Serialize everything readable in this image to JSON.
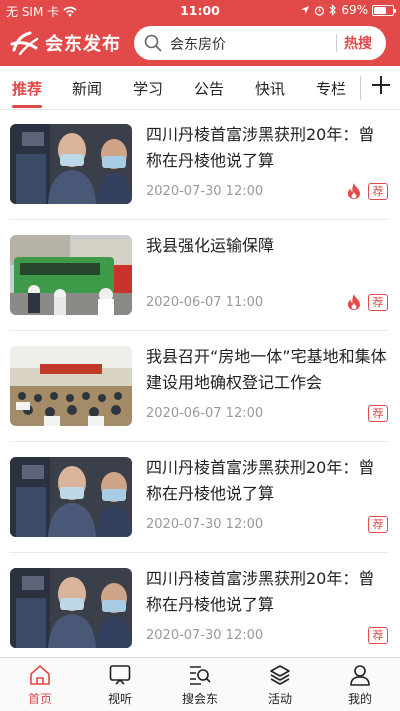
{
  "status_bar": {
    "carrier": "无 SIM 卡",
    "time": "11:00",
    "battery_text": "69%",
    "battery_level": 0.69
  },
  "header": {
    "logo_text": "会东发布",
    "search_placeholder": "会东房价",
    "hot_search_label": "热搜",
    "brand_color": "#e24a4a"
  },
  "tabs": [
    {
      "label": "推荐",
      "active": true
    },
    {
      "label": "新闻",
      "active": false
    },
    {
      "label": "学习",
      "active": false
    },
    {
      "label": "公告",
      "active": false
    },
    {
      "label": "快讯",
      "active": false
    },
    {
      "label": "专栏",
      "active": false
    }
  ],
  "news": [
    {
      "title": "四川丹棱首富涉黑获刑20年：曾称在丹棱他说了算",
      "date": "2020-07-30 12:00",
      "hot": true,
      "badge": "荐",
      "image": "court"
    },
    {
      "title": "我县强化运输保障",
      "date": "2020-06-07 11:00",
      "hot": true,
      "badge": "荐",
      "image": "bus"
    },
    {
      "title": "我县召开“房地一体”宅基地和集体建设用地确权登记工作会",
      "date": "2020-06-07 12:00",
      "hot": false,
      "badge": "荐",
      "image": "meeting"
    },
    {
      "title": "四川丹棱首富涉黑获刑20年：曾称在丹棱他说了算",
      "date": "2020-07-30 12:00",
      "hot": false,
      "badge": "荐",
      "image": "court"
    },
    {
      "title": "四川丹棱首富涉黑获刑20年：曾称在丹棱他说了算",
      "date": "2020-07-30 12:00",
      "hot": false,
      "badge": "荐",
      "image": "court"
    }
  ],
  "bottom_nav": [
    {
      "label": "首页",
      "icon": "home-icon",
      "active": true
    },
    {
      "label": "视听",
      "icon": "tv-icon",
      "active": false
    },
    {
      "label": "搜会东",
      "icon": "search-list-icon",
      "active": false
    },
    {
      "label": "活动",
      "icon": "layers-icon",
      "active": false
    },
    {
      "label": "我的",
      "icon": "user-icon",
      "active": false
    }
  ]
}
